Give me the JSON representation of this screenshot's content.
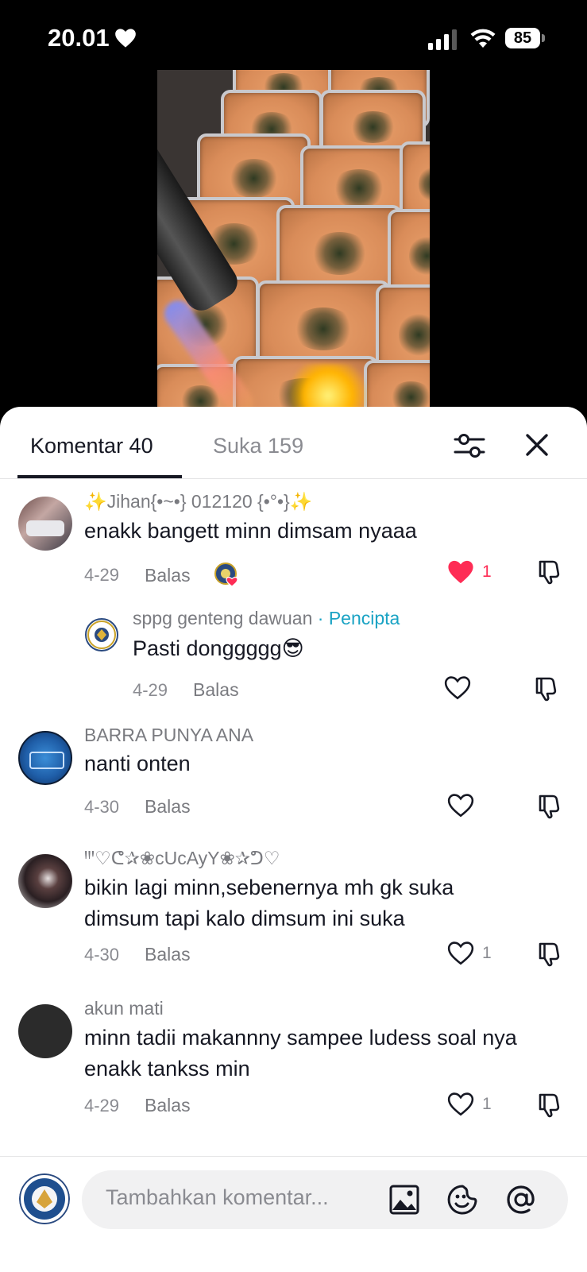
{
  "status_bar": {
    "time": "20.01",
    "battery": "85"
  },
  "tabs": [
    {
      "label": "Komentar 40"
    },
    {
      "label": "Suka 159"
    }
  ],
  "comments": [
    {
      "username": "✨Jihan{•~•} 012120 {•°•}✨",
      "text": "enakk bangett minn dimsam nyaaa",
      "date": "4-29",
      "reply": "Balas",
      "likes": "1",
      "liked": true
    },
    {
      "username": "sppg genteng dawuan",
      "badge": "· Pencipta",
      "text": "Pasti donggggg😎",
      "date": "4-29",
      "reply": "Balas",
      "likes": ""
    },
    {
      "username": "BARRA PUNYA ANA",
      "text": "nanti onten",
      "date": "4-30",
      "reply": "Balas",
      "likes": ""
    },
    {
      "username": "ꞋꞋꞌ♡ᕦ✰❀cUcAyY❀✰ᕤ♡",
      "text": "bikin lagi minn,sebenernya mh gk suka dimsum tapi kalo dimsum ini suka",
      "date": "4-30",
      "reply": "Balas",
      "likes": "1"
    },
    {
      "username": "akun mati",
      "text": "minn tadii makannny sampee ludess soal nya enakk tankss min",
      "date": "4-29",
      "reply": "Balas",
      "likes": "1"
    }
  ],
  "composer": {
    "placeholder": "Tambahkan komentar..."
  },
  "colors": {
    "accent_like": "#fe2c55",
    "creator_label": "#1aa3c4"
  }
}
